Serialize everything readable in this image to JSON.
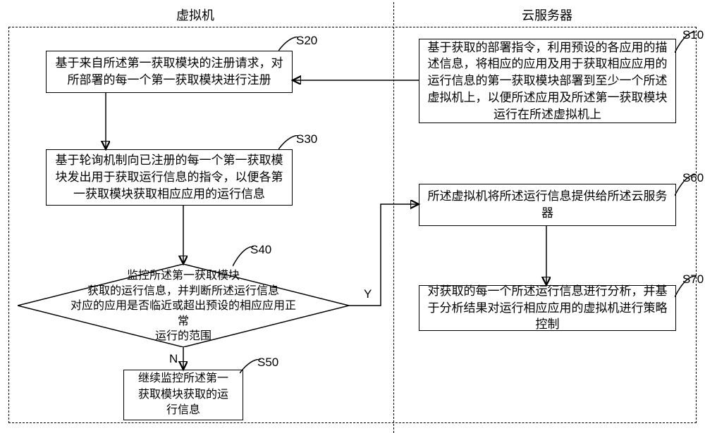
{
  "headers": {
    "left": "虚拟机",
    "right": "云服务器"
  },
  "steps": {
    "s10": {
      "label": "S10",
      "text": "基于获取的部署指令，利用预设的各应用的描述信息，将相应的应用及用于获取相应应用的运行信息的第一获取模块部署到至少一个所述虚拟机上，以便所述应用及所述第一获取模块运行在所述虚拟机上"
    },
    "s20": {
      "label": "S20",
      "text": "基于来自所述第一获取模块的注册请求，对所部署的每一个第一获取模块进行注册"
    },
    "s30": {
      "label": "S30",
      "text": "基于轮询机制向已注册的每一个第一获取模块发出用于获取运行信息的指令，以便各第一获取模块获取相应应用的运行信息"
    },
    "s40": {
      "label": "S40",
      "text": "监控所述第一获取模块\n获取的运行信息，并判断所述运行信息\n对应的应用是否临近或超出预设的相应应用正常\n运行的范围"
    },
    "s50": {
      "label": "S50",
      "text": "继续监控所述第一\n获取模块获取的运\n行信息"
    },
    "s60": {
      "label": "S60",
      "text": "所述虚拟机将所述运行信息提供给所述云服务器"
    },
    "s70": {
      "label": "S70",
      "text": "对获取的每一个所述运行信息进行分析，并基于分析结果对运行相应应用的虚拟机进行策略控制"
    }
  },
  "branches": {
    "yes": "Y",
    "no": "N"
  }
}
